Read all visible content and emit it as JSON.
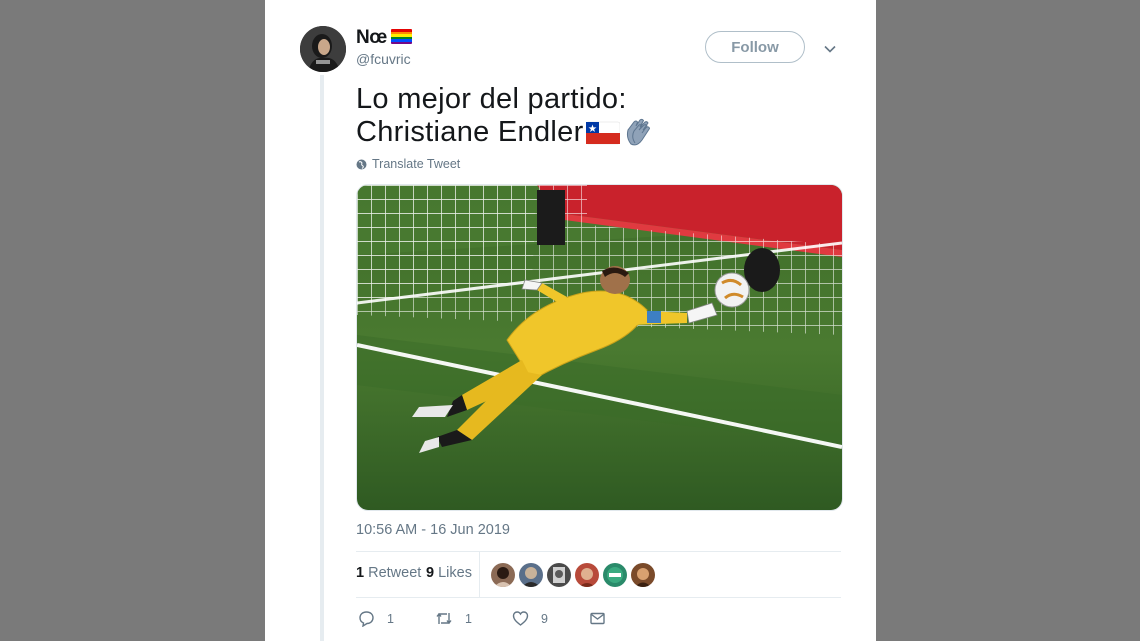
{
  "tweet": {
    "author": {
      "display_name": "Nœ",
      "handle": "@fcuvric",
      "avatar_icon": "avatar-image",
      "badge_icon": "rainbow-flag-icon"
    },
    "follow_label": "Follow",
    "text_line1": "Lo mejor del partido:",
    "text_line2": "Christiane Endler",
    "text_emojis": [
      "chile-flag-icon",
      "clapping-hands-icon"
    ],
    "translate_label": "Translate Tweet",
    "media_description_icon": "goalkeeper-diving-photo",
    "timestamp": "10:56 AM - 16 Jun 2019",
    "stats": {
      "retweets_count": "1",
      "retweets_label": "Retweet",
      "likes_count": "9",
      "likes_label": "Likes"
    },
    "actions": {
      "reply_count": "1",
      "retweet_count": "1",
      "like_count": "9"
    }
  },
  "colors": {
    "background": "#7a7a7a",
    "card": "#ffffff",
    "text_primary": "#14171a",
    "text_secondary": "#657786",
    "border": "#e6ecf0"
  }
}
